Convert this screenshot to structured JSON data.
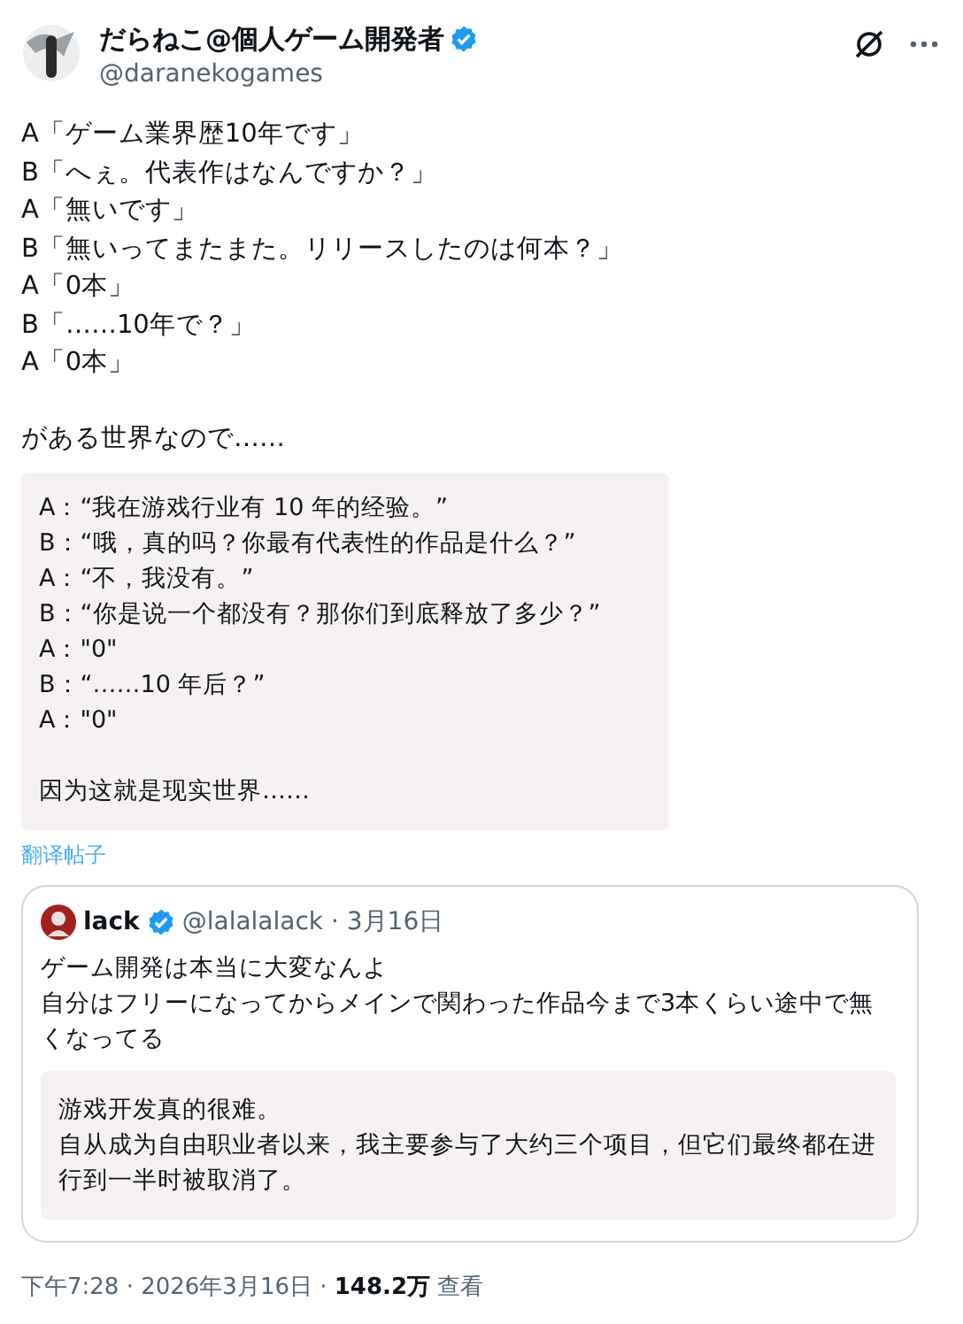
{
  "author": {
    "name": "だらねこ@個人ゲーム開発者",
    "verified": true,
    "handle": "@daranekogames"
  },
  "post_lines": [
    "A「ゲーム業界歴10年です」",
    "B「へぇ。代表作はなんですか？」",
    "A「無いです」",
    "B「無いってまたまた。リリースしたのは何本？」",
    "A「0本」",
    "B「……10年で？」",
    "A「0本」"
  ],
  "post_tail": "がある世界なので……",
  "translation": {
    "lines": [
      "A：“我在游戏行业有 10 年的经验。”",
      "B：“哦，真的吗？你最有代表性的作品是什么？”",
      "A：“不，我没有。”",
      "B：“你是说一个都没有？那你们到底释放了多少？”",
      "A：\"0\"",
      "B：“……10 年后？”",
      "A：\"0\""
    ],
    "closing": "因为这就是现实世界……"
  },
  "translate_link": "翻译帖子",
  "quote": {
    "name": "lack",
    "verified": true,
    "handle_date": "@lalalalack · 3月16日",
    "lines": [
      "ゲーム開発は本当に大変なんよ",
      "自分はフリーになってからメインで関わった作品今まで3本くらい途中で無くなってる"
    ],
    "translation": [
      "游戏开发真的很难。",
      "自从成为自由职业者以来，我主要参与了大约三个项目，但它们最终都在进行到一半时被取消了。"
    ]
  },
  "footer": "下午7:28 · 2026年3月16日 · **148.2万** 查看"
}
